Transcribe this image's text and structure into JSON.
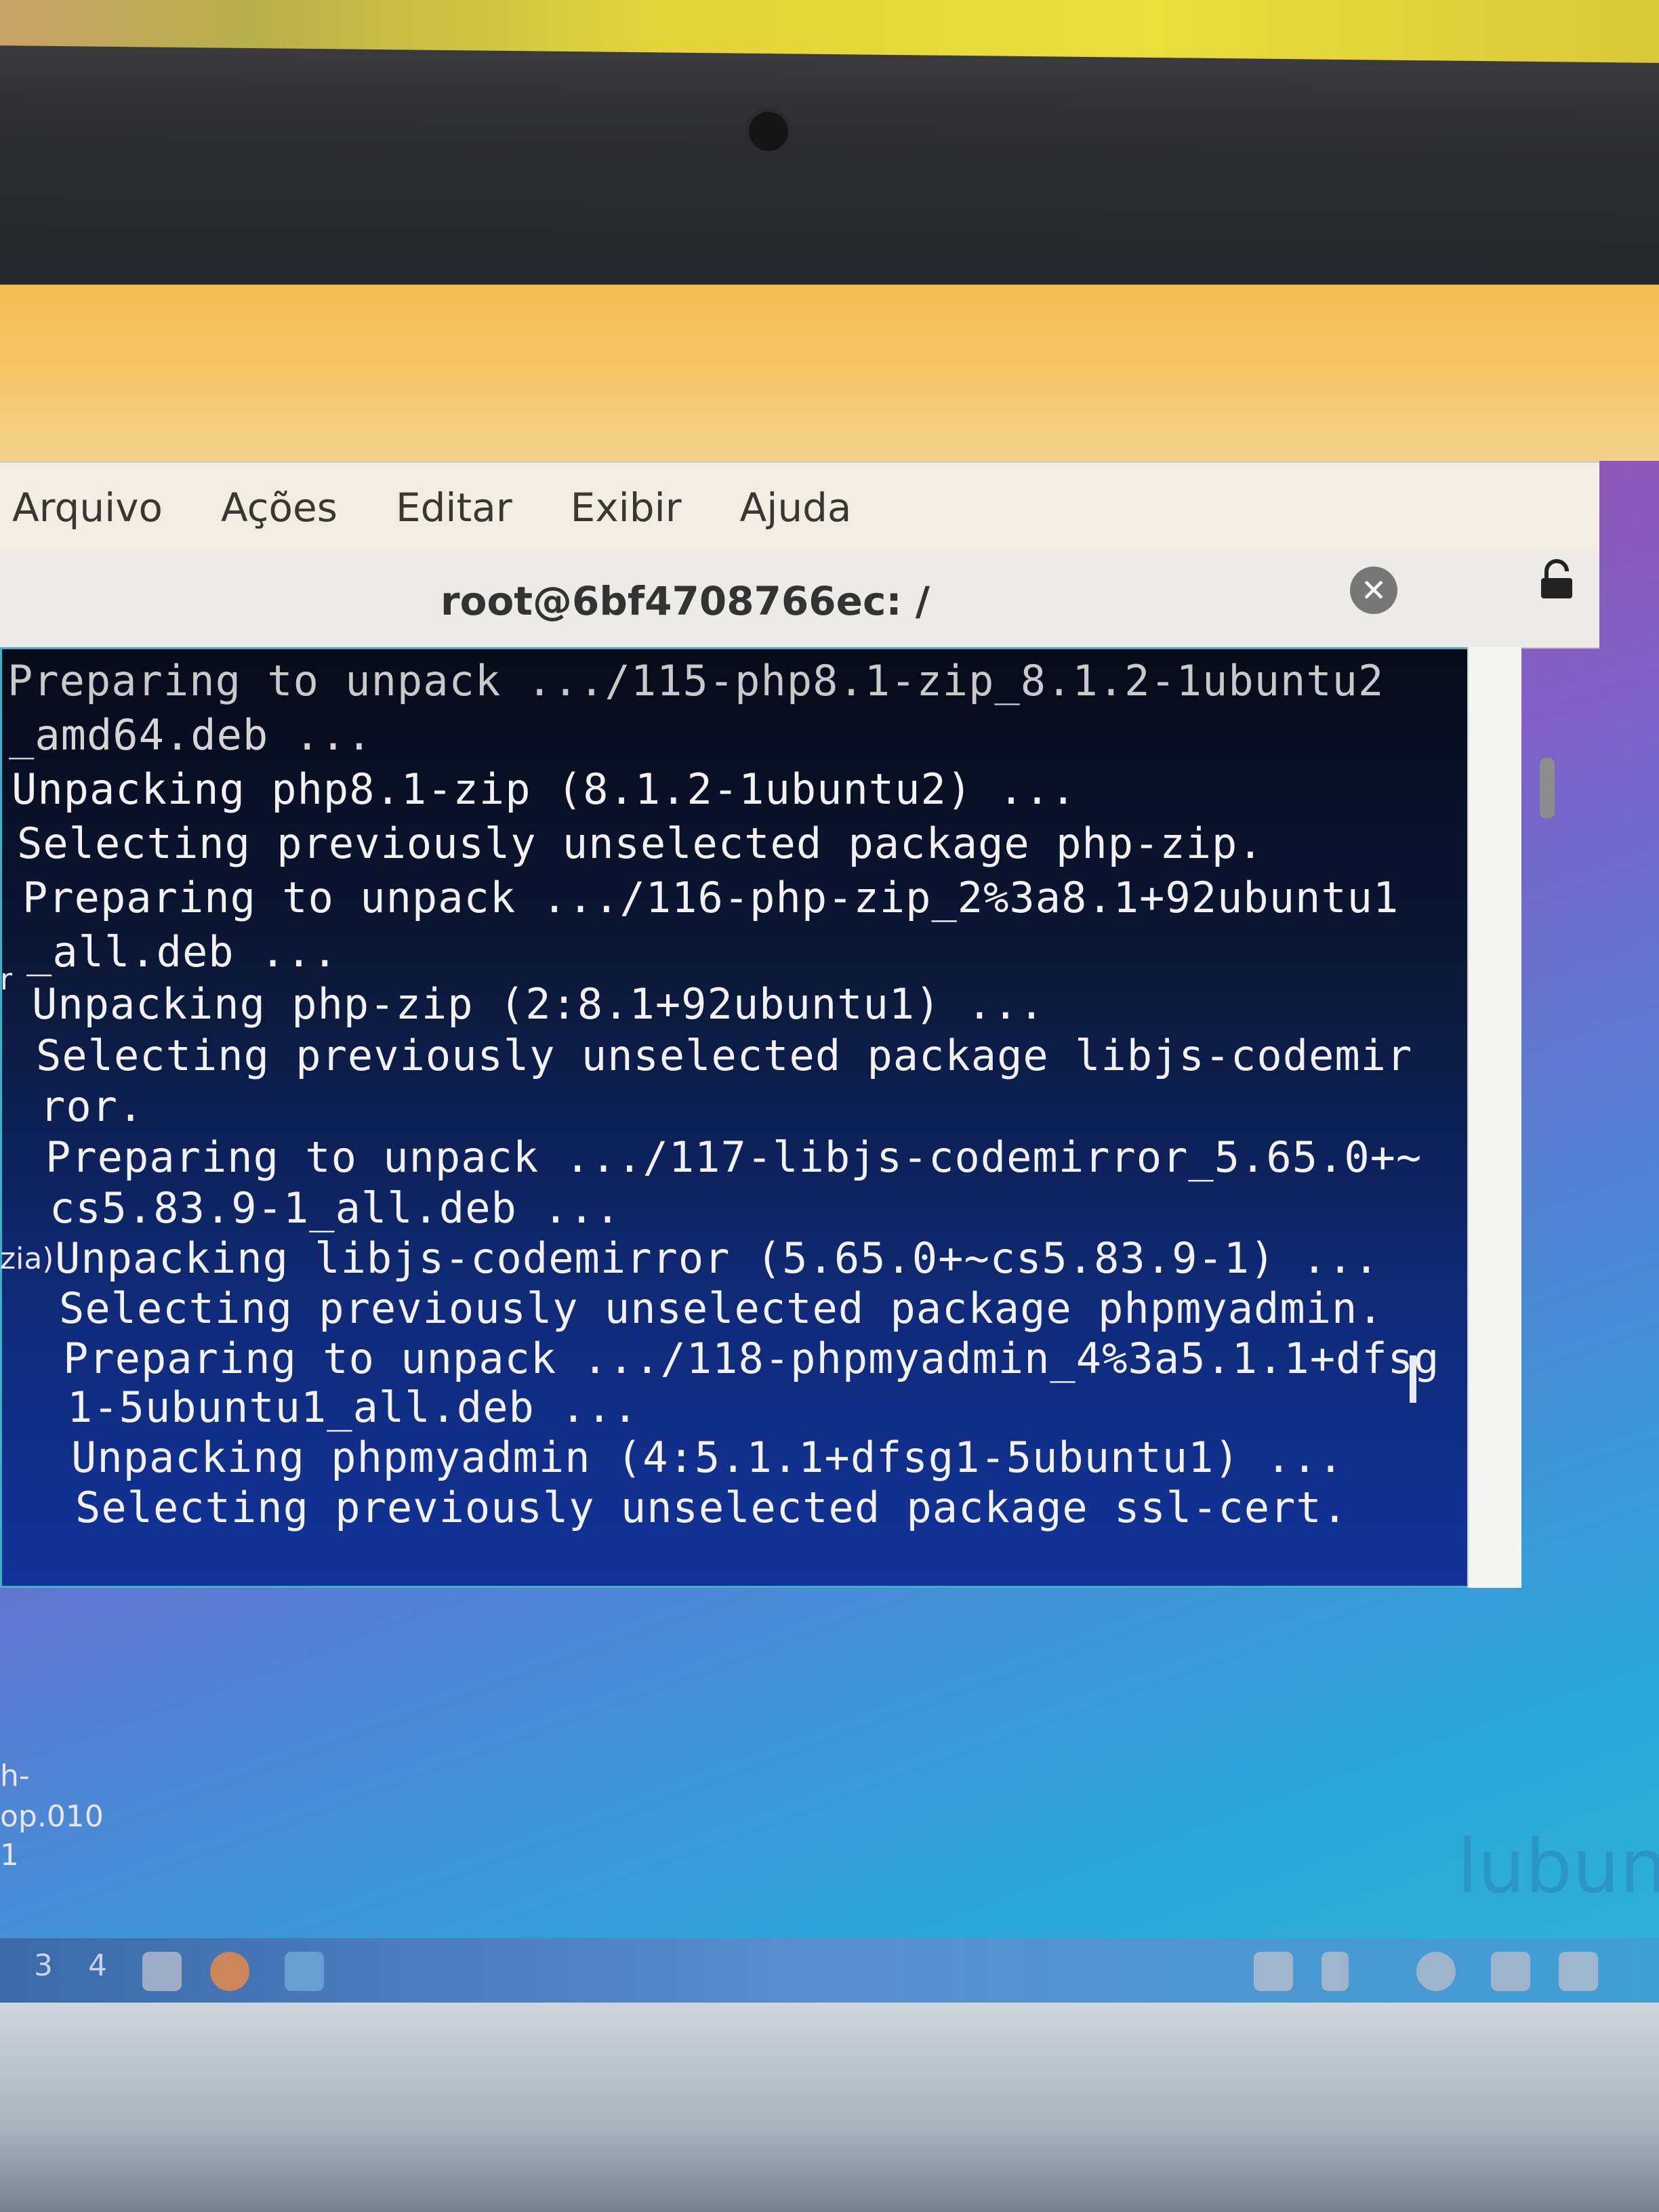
{
  "menu": {
    "items": [
      "Arquivo",
      "Ações",
      "Editar",
      "Exibir",
      "Ajuda"
    ]
  },
  "window": {
    "title": "root@6bf4708766ec: /",
    "close_glyph": "✕",
    "lock_icon": "lock-icon"
  },
  "terminal": {
    "lines": [
      "Preparing to unpack .../115-php8.1-zip_8.1.2-1ubuntu2",
      "_amd64.deb ...",
      "Unpacking php8.1-zip (8.1.2-1ubuntu2) ...",
      "Selecting previously unselected package php-zip.",
      "Preparing to unpack .../116-php-zip_2%3a8.1+92ubuntu1",
      "_all.deb ...",
      "Unpacking php-zip (2:8.1+92ubuntu1) ...",
      "Selecting previously unselected package libjs-codemir",
      "ror.",
      "Preparing to unpack .../117-libjs-codemirror_5.65.0+~",
      "cs5.83.9-1_all.deb ...",
      "Unpacking libjs-codemirror (5.65.0+~cs5.83.9-1) ...",
      "Selecting previously unselected package phpmyadmin.",
      "Preparing to unpack .../118-phpmyadmin_4%3a5.1.1+dfsg",
      "1-5ubuntu1_all.deb ...",
      "Unpacking phpmyadmin (4:5.1.1+dfsg1-5ubuntu1) ...",
      "Selecting previously unselected package ssl-cert."
    ]
  },
  "desktop": {
    "side_labels": [
      "r",
      "zia)",
      "h-",
      "op.010",
      "1"
    ],
    "brand": "lubun",
    "workspaces": [
      "3",
      "4"
    ]
  }
}
